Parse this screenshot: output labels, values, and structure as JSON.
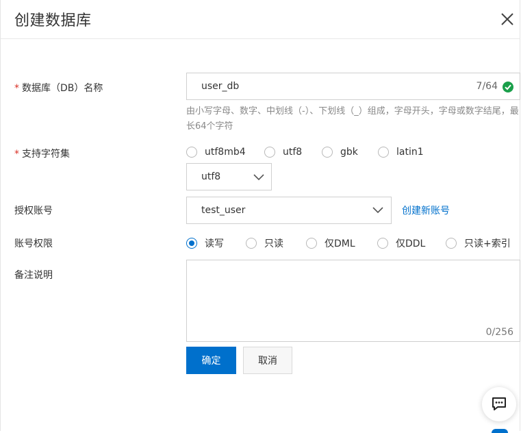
{
  "dialog": {
    "title": "创建数据库",
    "close_icon": "close-icon"
  },
  "form": {
    "db_name": {
      "required_mark": "*",
      "label": "数据库（DB）名称",
      "value": "user_db",
      "counter": "7/64",
      "status_icon": "check-circle-icon",
      "hint": "由小写字母、数字、中划线（-）、下划线（_）组成，字母开头，字母或数字结尾，最长64个字符"
    },
    "charset": {
      "required_mark": "*",
      "label": "支持字符集",
      "options": [
        "utf8mb4",
        "utf8",
        "gbk",
        "latin1"
      ],
      "checked": "none",
      "select_value": "utf8"
    },
    "account": {
      "label": "授权账号",
      "value": "test_user",
      "create_link": "创建新账号"
    },
    "permission": {
      "label": "账号权限",
      "options": [
        "读写",
        "只读",
        "仅DML",
        "仅DDL",
        "只读+索引"
      ],
      "checked": "读写"
    },
    "remark": {
      "label": "备注说明",
      "value": "",
      "counter": "0/256"
    }
  },
  "actions": {
    "confirm_label": "确定",
    "cancel_label": "取消"
  },
  "floating": {
    "chat_icon": "chat-bubble-icon"
  },
  "colors": {
    "primary": "#0070cc",
    "required": "#d93026",
    "success": "#1a9f4a"
  }
}
